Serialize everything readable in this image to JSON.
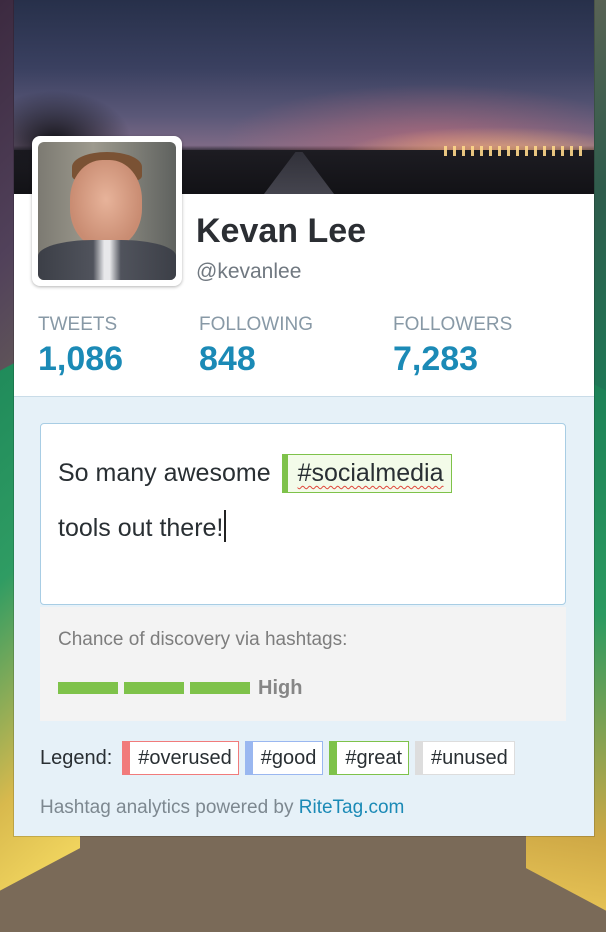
{
  "profile": {
    "name": "Kevan Lee",
    "handle": "@kevanlee"
  },
  "stats": [
    {
      "label": "TWEETS",
      "value": "1,086"
    },
    {
      "label": "FOLLOWING",
      "value": "848"
    },
    {
      "label": "FOLLOWERS",
      "value": "7,283"
    }
  ],
  "tweet": {
    "line1_prefix": "So many awesome",
    "hashtag": "#socialmedia",
    "line2": "tools out there!"
  },
  "discovery": {
    "label": "Chance of discovery via hashtags:",
    "level": "High",
    "segments_filled": 3,
    "segments_total": 3
  },
  "legend": {
    "title": "Legend:",
    "items": [
      {
        "label": "#overused",
        "color": "#f17b7b"
      },
      {
        "label": "#good",
        "color": "#9ab7f0"
      },
      {
        "label": "#great",
        "color": "#7ec24a"
      },
      {
        "label": "#unused",
        "color": "#dddddd"
      }
    ]
  },
  "footer": {
    "prefix": "Hashtag analytics powered by",
    "link": "RiteTag.com"
  },
  "colors": {
    "accent": "#1b8ab6",
    "panel": "#e6f1f8"
  }
}
